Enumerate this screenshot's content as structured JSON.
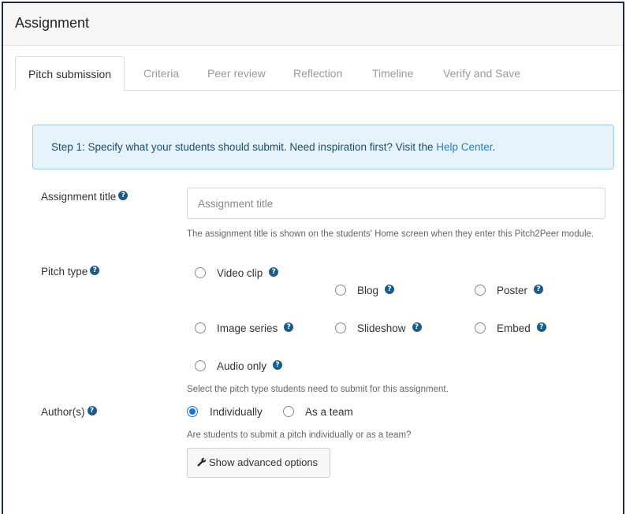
{
  "header": {
    "title": "Assignment"
  },
  "tabs": [
    {
      "label": "Pitch submission",
      "active": true
    },
    {
      "label": "Criteria"
    },
    {
      "label": "Peer review"
    },
    {
      "label": "Reflection"
    },
    {
      "label": "Timeline"
    },
    {
      "label": "Verify and Save"
    }
  ],
  "info": {
    "text": "Step 1: Specify what your students should submit. Need inspiration first? Visit the ",
    "link": "Help Center",
    "after": "."
  },
  "assignment_title": {
    "label": "Assignment title",
    "placeholder": "Assignment title",
    "value": "",
    "hint": "The assignment title is shown on the students' Home screen when they enter this Pitch2Peer module."
  },
  "pitch_type": {
    "label": "Pitch type",
    "options": [
      "Video clip",
      "Blog",
      "Poster",
      "Image series",
      "Slideshow",
      "Embed",
      "Audio only"
    ],
    "selected": null,
    "hint": "Select the pitch type students need to submit for this assignment."
  },
  "authors": {
    "label": "Author(s)",
    "options": [
      "Individually",
      "As a team"
    ],
    "selected": "Individually",
    "hint": "Are students to submit a pitch individually or as a team?"
  },
  "advanced_button": {
    "label": "Show advanced options",
    "icon": "wrench-icon"
  },
  "help_icon": "?",
  "colors": {
    "accent": "#1a73e8",
    "help_icon": "#1e5b86",
    "info_bg": "#e6f3fb",
    "link": "#2a7dbd"
  }
}
